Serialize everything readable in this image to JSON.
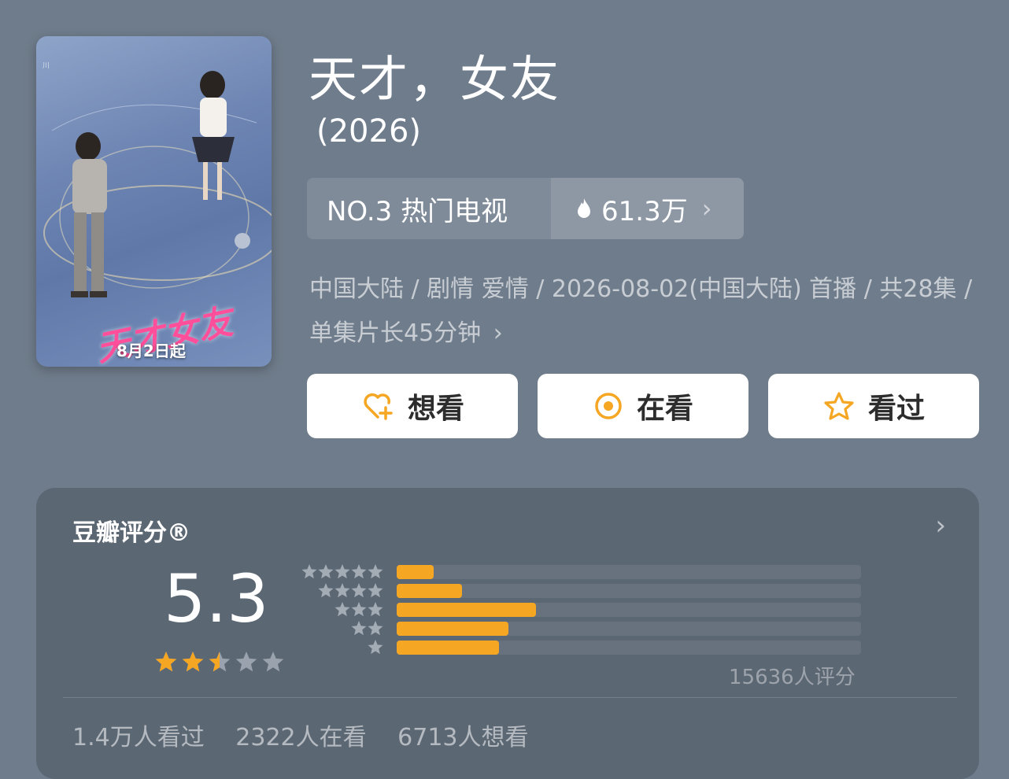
{
  "show": {
    "title": "天才，女友",
    "year": "(2026)",
    "poster_caption": "8月2日起",
    "poster_logo": "天才女友"
  },
  "rank": {
    "label": "NO.3 热门电视",
    "heat": "61.3万",
    "chevron_glyph": "›"
  },
  "meta": {
    "line": "中国大陆 / 剧情 爱情 / 2026-08-02(中国大陆) 首播 / 共28集 / 单集片长45分钟",
    "chevron_glyph": "›"
  },
  "actions": {
    "want_label": "想看",
    "watching_label": "在看",
    "watched_label": "看过"
  },
  "rating": {
    "title": "豆瓣评分®",
    "score": "5.3",
    "stars_out_of_5": 2.5,
    "distribution_percent": {
      "5": 8,
      "4": 14,
      "3": 30,
      "2": 24,
      "1": 22
    },
    "votes": "15636人评分",
    "chevron_glyph": "›"
  },
  "stats": {
    "watched": "1.4万人看过",
    "watching": "2322人在看",
    "want": "6713人想看"
  },
  "colors": {
    "background": "#6f7c8b",
    "card": "#5c6774",
    "accent": "#f5a623",
    "star_empty": "#9aa3ad"
  },
  "icons": {
    "heart_plus": "heart-plus-icon",
    "target": "target-icon",
    "star": "star-icon",
    "fire": "fire-icon"
  }
}
